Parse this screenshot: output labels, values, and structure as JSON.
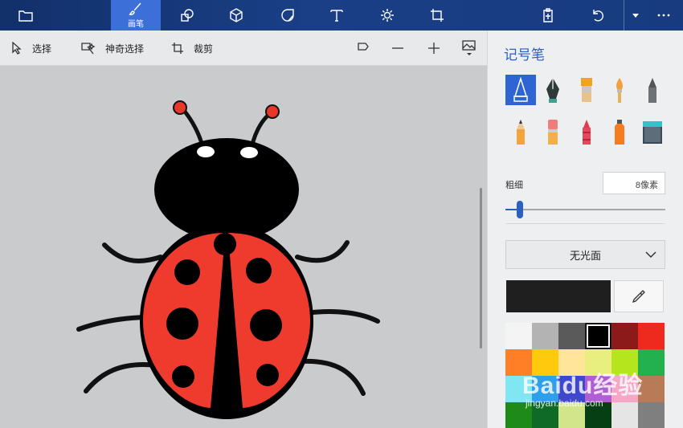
{
  "topbar": {
    "tabs": [
      {
        "icon": "folder-icon"
      },
      {
        "label": "画笔",
        "icon": "brush-icon"
      },
      {
        "icon": "2d-shapes-icon"
      },
      {
        "icon": "3d-shapes-icon"
      },
      {
        "icon": "stickers-icon"
      },
      {
        "icon": "text-icon"
      },
      {
        "icon": "effects-icon"
      },
      {
        "icon": "canvas-icon"
      }
    ],
    "right": [
      "paste-icon",
      "undo-icon",
      "history-dropdown-icon",
      "more-icon"
    ]
  },
  "subbar": {
    "select_label": "选择",
    "magic_select_label": "神奇选择",
    "crop_label": "裁剪"
  },
  "panel": {
    "title": "记号笔",
    "brushes": [
      "marker",
      "calligraphy-pen",
      "oil-brush",
      "watercolor",
      "pixel-pen",
      "pencil",
      "eraser",
      "crayon",
      "spray-can",
      "fill-bucket"
    ],
    "selected_brush": "marker",
    "size_label": "粗细",
    "size_value": "8像素",
    "size_fraction": 0.09,
    "finish_label": "无光面",
    "current_color": "#1f1f1f"
  },
  "palette": [
    [
      "#f4f4f4",
      "#b3b3b3",
      "#5a5a5a",
      "#000000",
      "#8c1a1a",
      "#ee2a1f"
    ],
    [
      "#ff7f27",
      "#ffc90e",
      "#ffe59a",
      "#e8ef7e",
      "#b5e61d",
      "#22b14c"
    ],
    [
      "#7fe6f2",
      "#2e9fe8",
      "#3f48cc",
      "#b15ed5",
      "#f5a7c6",
      "#b97a57"
    ],
    [
      "#1e8a17",
      "#0f6a28",
      "#d2e58a",
      "#053f13",
      "#e5e5e5",
      "#7f7f7f"
    ]
  ],
  "watermark": {
    "text": "Baidu经验",
    "sub": "jingyan.baidu.com"
  }
}
